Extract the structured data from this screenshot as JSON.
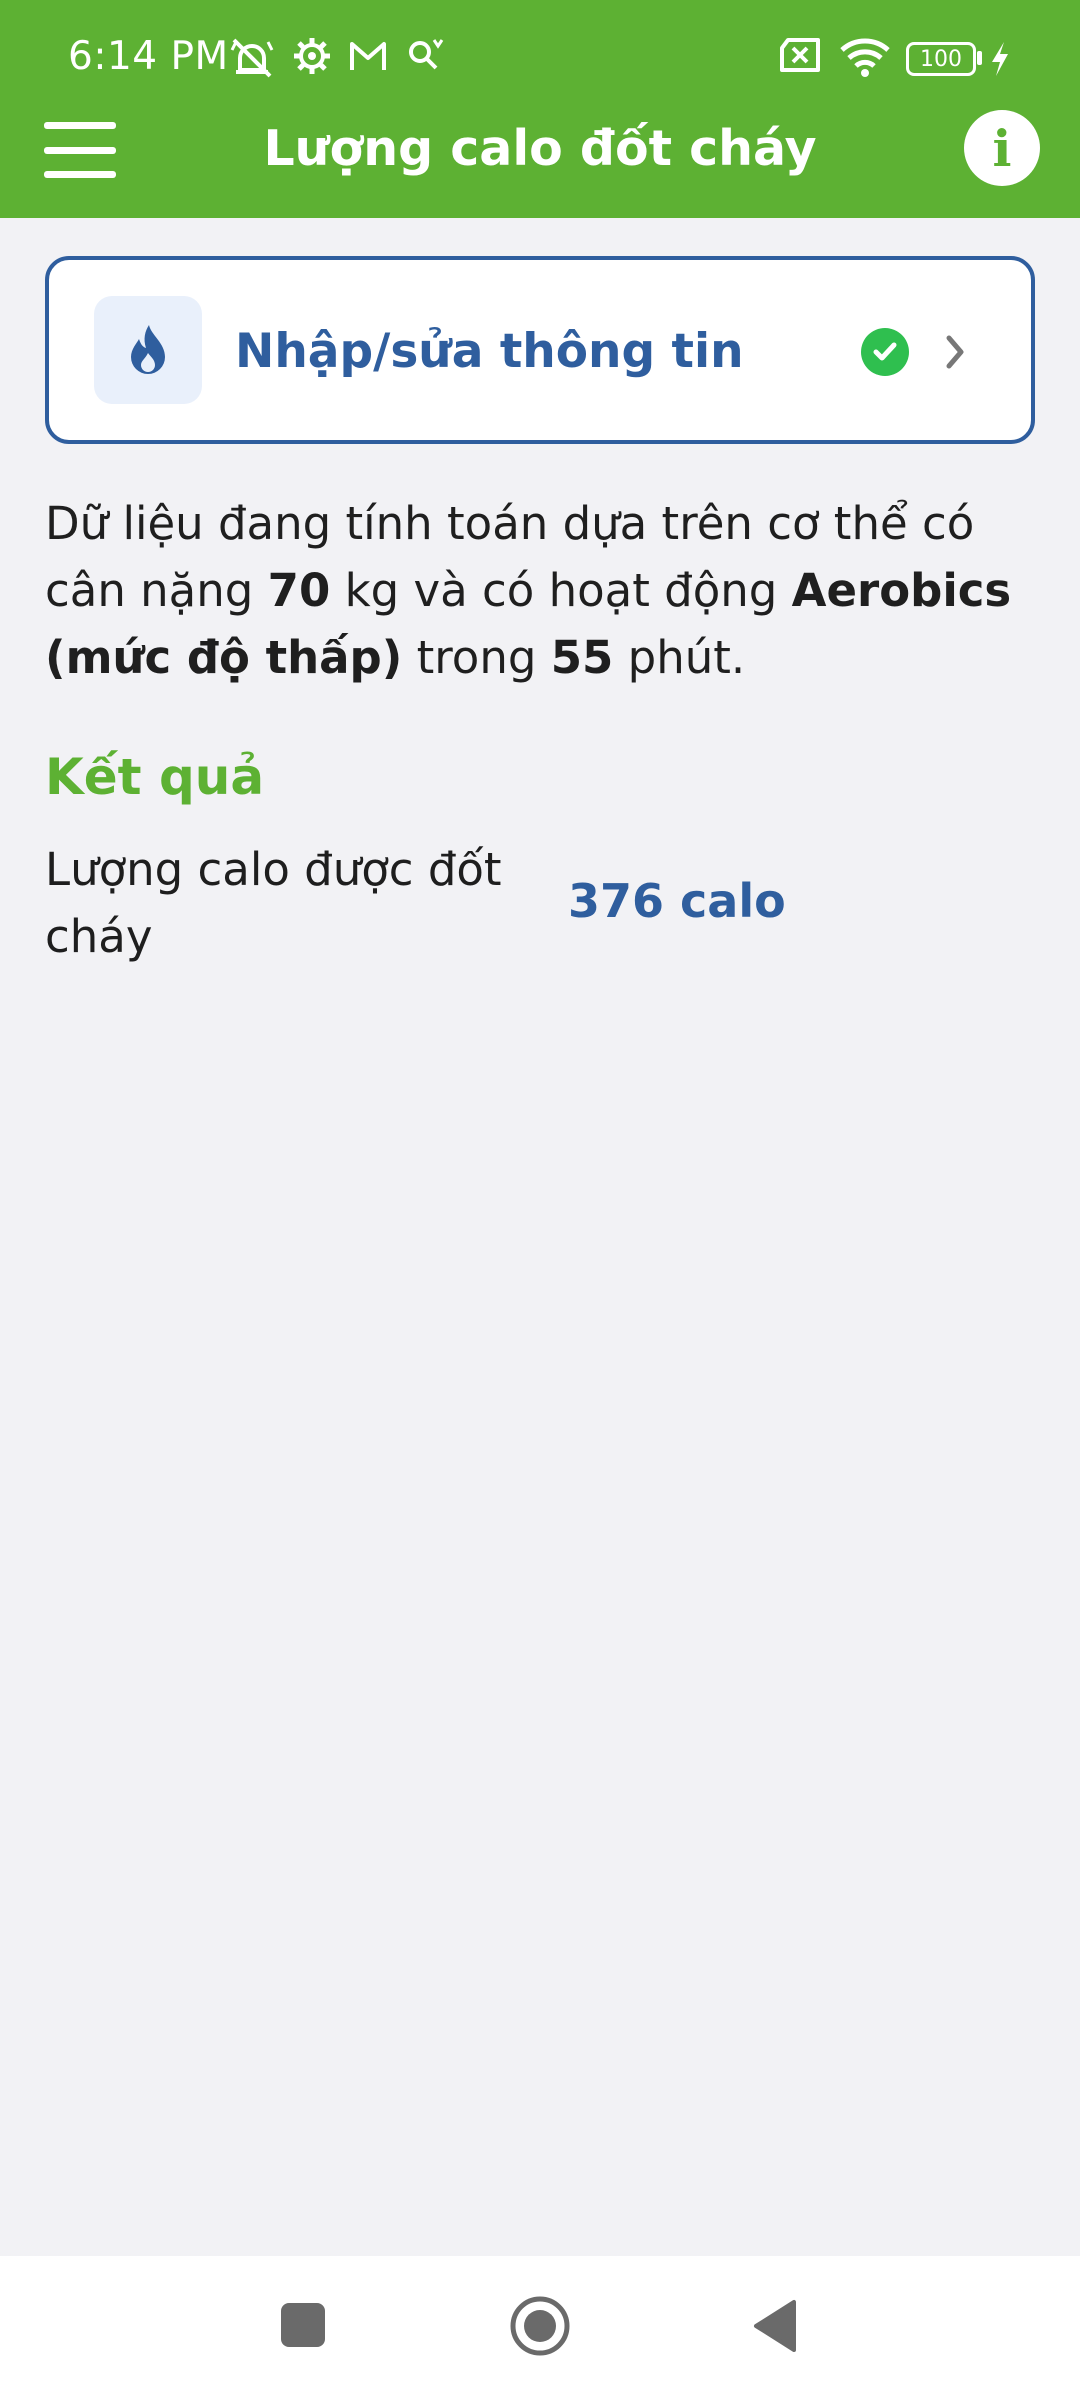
{
  "status_bar": {
    "time": "6:14 PM",
    "left_icons": [
      "muted-alarm-icon",
      "settings-gear-icon",
      "gmail-icon",
      "search-tools-icon"
    ],
    "right_icons": [
      "sim-x-icon",
      "wifi-icon",
      "battery-icon",
      "charging-icon"
    ],
    "battery": "100"
  },
  "toolbar": {
    "title": "Lượng calo đốt cháy",
    "info_label": "i"
  },
  "input_card": {
    "label": "Nhập/sửa thông tin",
    "status": "complete"
  },
  "description": {
    "part1": "Dữ liệu đang tính toán dựa trên cơ thể có cân nặng ",
    "weight": "70",
    "part2": " kg và có hoạt động ",
    "activity": "Aerobics (mức độ thấp)",
    "part3": " trong ",
    "duration": "55",
    "part4": " phút."
  },
  "result": {
    "section_title": "Kết quả",
    "label": "Lượng calo được đốt cháy",
    "value": "376 calo"
  },
  "colors": {
    "primary_green": "#5db133",
    "accent_blue": "#2f5e9e",
    "check_green": "#2fbf4f",
    "background": "#f2f2f5"
  }
}
